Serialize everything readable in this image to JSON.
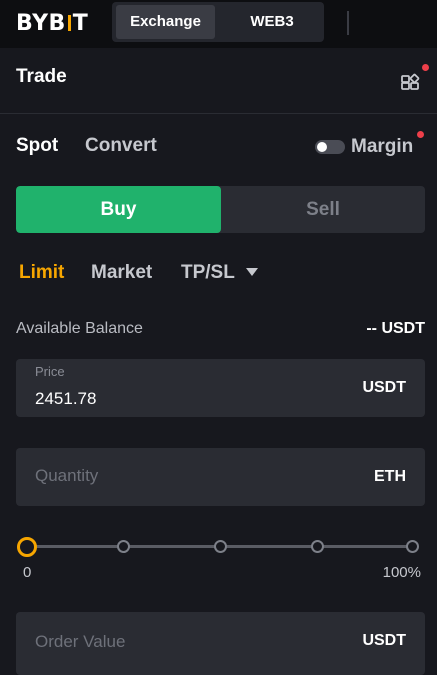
{
  "header": {
    "logo_text": "BYBIT",
    "tabs": [
      {
        "label": "Exchange",
        "active": true
      },
      {
        "label": "WEB3",
        "active": false
      }
    ]
  },
  "trade": {
    "title": "Trade",
    "modes": [
      {
        "label": "Spot",
        "active": true
      },
      {
        "label": "Convert",
        "active": false
      }
    ],
    "margin": {
      "label": "Margin",
      "enabled": false
    },
    "side": {
      "buy_label": "Buy",
      "sell_label": "Sell",
      "selected": "Buy"
    },
    "order_types": [
      {
        "label": "Limit",
        "active": true
      },
      {
        "label": "Market",
        "active": false
      },
      {
        "label": "TP/SL",
        "active": false,
        "dropdown": true
      }
    ],
    "balance": {
      "label": "Available Balance",
      "value": "-- USDT"
    },
    "price": {
      "label": "Price",
      "value": "2451.78",
      "unit": "USDT"
    },
    "quantity": {
      "placeholder": "Quantity",
      "unit": "ETH"
    },
    "slider": {
      "min_label": "0",
      "max_label": "100%",
      "value_percent": 0,
      "stops_percent": [
        0,
        25,
        50,
        75,
        100
      ]
    },
    "order_value": {
      "placeholder": "Order Value",
      "unit": "USDT"
    }
  },
  "colors": {
    "accent": "#f7a600",
    "buy": "#20b26c",
    "notification": "#ee3f4a",
    "background": "#17181e",
    "field_bg": "#2a2c33"
  }
}
